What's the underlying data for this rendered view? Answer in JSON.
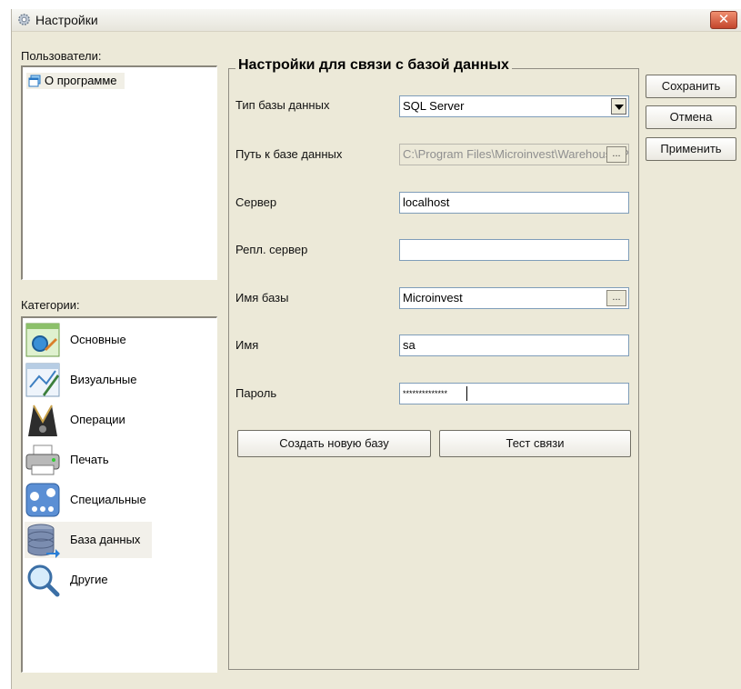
{
  "window": {
    "title": "Настройки",
    "close_icon": "close-icon"
  },
  "users": {
    "label": "Пользователи:",
    "items": [
      {
        "label": "О программе",
        "icon": "user-group-icon"
      }
    ]
  },
  "categories": {
    "label": "Категории:",
    "items": [
      {
        "label": "Основные",
        "icon": "general-settings-icon"
      },
      {
        "label": "Визуальные",
        "icon": "visual-settings-icon"
      },
      {
        "label": "Операции",
        "icon": "operations-icon"
      },
      {
        "label": "Печать",
        "icon": "printer-icon"
      },
      {
        "label": "Специальные",
        "icon": "special-settings-icon"
      },
      {
        "label": "База данных",
        "icon": "database-icon",
        "selected": true
      },
      {
        "label": "Другие",
        "icon": "magnifier-icon"
      }
    ]
  },
  "db_settings": {
    "title": "Настройки для связи с базой данных",
    "db_type_label": "Тип базы данных",
    "db_type_value": "SQL Server",
    "db_path_label": "Путь к базе данных",
    "db_path_value": "C:\\Program Files\\Microinvest\\Warehouse Pro\\",
    "server_label": "Сервер",
    "server_value": "localhost",
    "repl_server_label": "Репл. сервер",
    "repl_server_value": "",
    "db_name_label": "Имя базы",
    "db_name_value": "Microinvest",
    "username_label": "Имя",
    "username_value": "sa",
    "password_label": "Пароль",
    "password_value": "**************",
    "ellipsis": "...",
    "create_db_button": "Создать новую базу",
    "test_connection_button": "Тест связи"
  },
  "actions": {
    "save": "Сохранить",
    "cancel": "Отмена",
    "apply": "Применить"
  },
  "colors": {
    "window_bg": "#ece9d8",
    "close_button": "#c3462c",
    "field_border": "#7f9db9"
  }
}
